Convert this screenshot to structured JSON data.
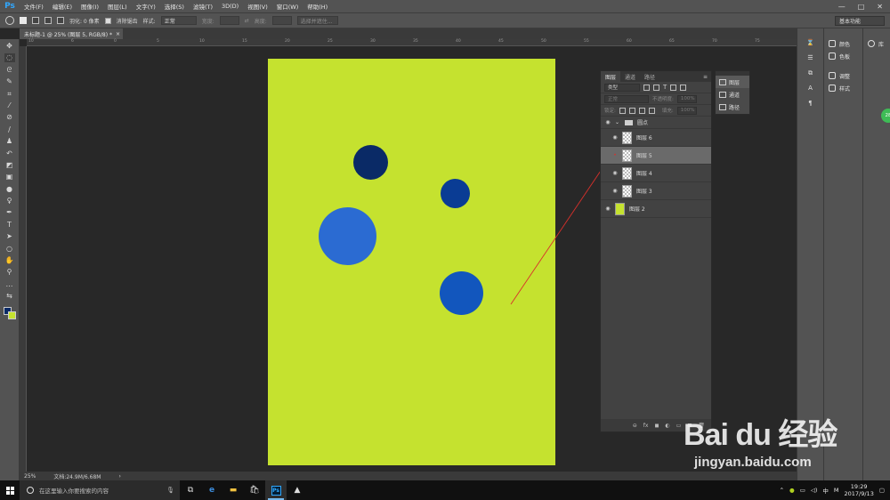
{
  "app": {
    "logo": "Ps",
    "menus": [
      "文件(F)",
      "编辑(E)",
      "图像(I)",
      "图层(L)",
      "文字(Y)",
      "选择(S)",
      "滤镜(T)",
      "3D(D)",
      "视图(V)",
      "窗口(W)",
      "帮助(H)"
    ],
    "window_controls": [
      "—",
      "□",
      "✕"
    ]
  },
  "options_bar": {
    "feather_label": "羽化: 0 像素",
    "antialias_label": "消除锯齿",
    "style_label": "样式:",
    "style_value": "正常",
    "width_label": "宽度:",
    "height_label": "高度:",
    "select_mask_label": "选择并遮住...",
    "workspace": "基本功能"
  },
  "document": {
    "tab_title": "未标题-1 @ 25% (图层 5, RGB/8) *",
    "tab_close": "×",
    "ruler_h": [
      "10",
      "6",
      "0",
      "5",
      "10",
      "15",
      "20",
      "25",
      "30",
      "35",
      "40",
      "45",
      "50",
      "55",
      "60",
      "65",
      "70",
      "75"
    ],
    "canvas_color": "#c5e22f",
    "circles": [
      {
        "name": "dark-navy-circle",
        "color": "#0a2a66"
      },
      {
        "name": "medium-blue-circle",
        "color": "#0a3c94"
      },
      {
        "name": "light-blue-circle",
        "color": "#2b6bd2"
      },
      {
        "name": "royal-blue-circle",
        "color": "#1256bd"
      }
    ]
  },
  "status_bar": {
    "zoom": "25%",
    "doc_info": "文档:24.9M/6.68M",
    "arrow": "›"
  },
  "layers_panel": {
    "tabs": [
      "图层",
      "通道",
      "路径"
    ],
    "active_tab": "图层",
    "filter_label": "类型",
    "blend_mode": "正常",
    "opacity_label": "不透明度:",
    "opacity_value": "100%",
    "lock_label": "锁定:",
    "fill_label": "填充:",
    "fill_value": "100%",
    "group_name": "圆点",
    "layers": [
      {
        "name": "图层 6",
        "selected": false,
        "visible": true
      },
      {
        "name": "图层 5",
        "selected": true,
        "visible": false
      },
      {
        "name": "图层 4",
        "selected": false,
        "visible": true
      },
      {
        "name": "图层 3",
        "selected": false,
        "visible": true
      }
    ],
    "background_layer": "图层 2",
    "bottom_icons": [
      "link-icon",
      "fx-icon",
      "mask-icon",
      "adjustment-icon",
      "folder-icon",
      "new-layer-icon",
      "trash-icon"
    ],
    "bottom_labels": [
      "⊖",
      "fx",
      "◼",
      "◐",
      "▭",
      "⊞",
      "🗑"
    ]
  },
  "mini_panel": {
    "items": [
      "图层",
      "通道",
      "路径"
    ]
  },
  "right_dock": {
    "panels": [
      "颜色",
      "色板",
      "调整",
      "样式"
    ],
    "library": "库",
    "badge": "28"
  },
  "watermark": {
    "logo": "Bai du 经验",
    "url": "jingyan.baidu.com"
  },
  "taskbar": {
    "search_placeholder": "在这里输入你要搜索的内容",
    "ime": "中",
    "ime_mode": "M",
    "time": "19:29",
    "date": "2017/9/13"
  }
}
